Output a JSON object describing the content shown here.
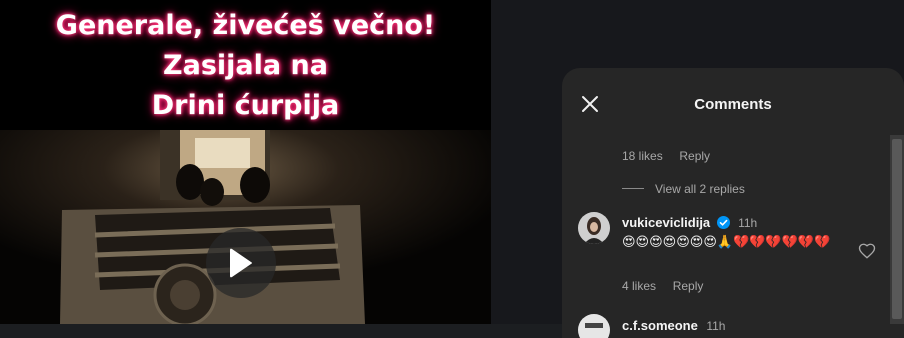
{
  "video": {
    "caption_line1": "Generale, živećeš večno! Zasijala na",
    "caption_line2": "Drini ćurpija"
  },
  "comments_panel": {
    "title": "Comments",
    "prev_comment": {
      "likes": "18 likes",
      "reply_label": "Reply",
      "view_replies": "View all 2 replies"
    },
    "comments": [
      {
        "username": "vukiceviclidija",
        "verified": true,
        "time": "11h",
        "text": "😍😍😍😍😍😍😍🙏💔💔💔💔💔💔",
        "likes": "4 likes",
        "reply_label": "Reply"
      },
      {
        "username": "c.f.someone",
        "time": "11h"
      }
    ]
  },
  "colors": {
    "caption_glow": "#ff2a72",
    "verified_badge": "#0095f6",
    "panel_bg": "#262626"
  }
}
